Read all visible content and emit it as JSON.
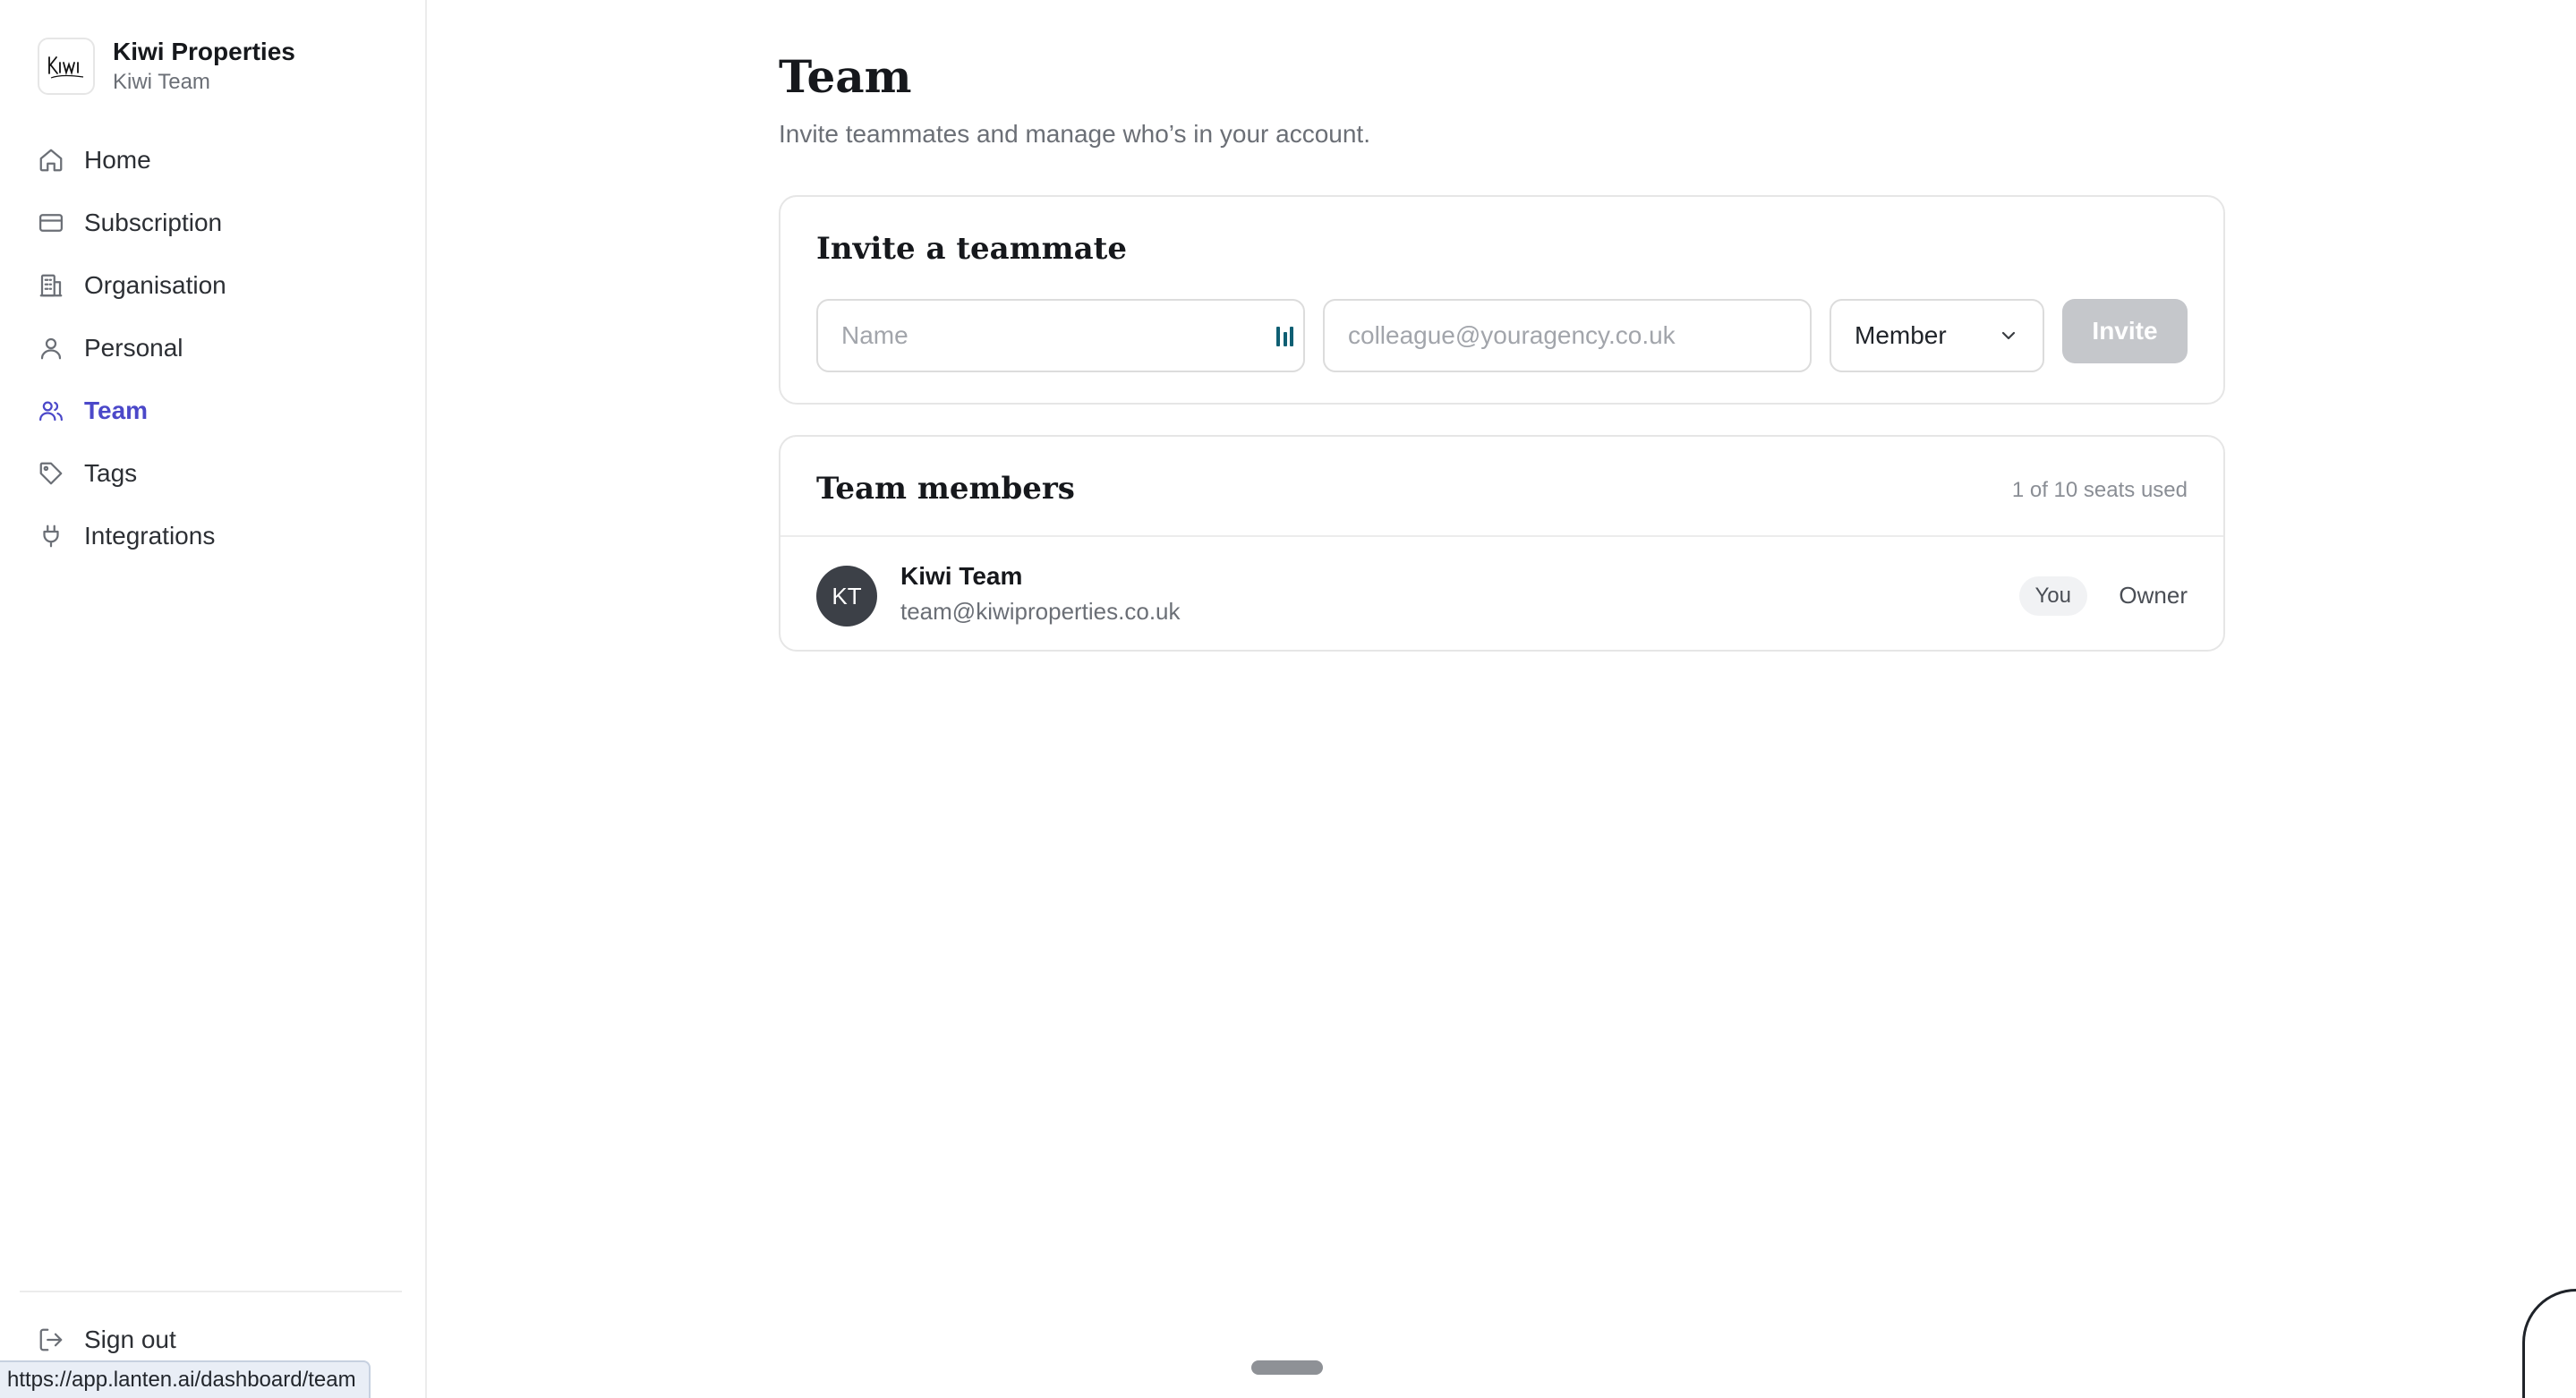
{
  "brand": {
    "name": "Kiwi Properties",
    "team": "Kiwi Team"
  },
  "nav": {
    "items": [
      {
        "label": "Home",
        "icon": "home-icon"
      },
      {
        "label": "Subscription",
        "icon": "credit-card-icon"
      },
      {
        "label": "Organisation",
        "icon": "building-icon"
      },
      {
        "label": "Personal",
        "icon": "user-icon"
      },
      {
        "label": "Team",
        "icon": "users-icon",
        "active": true
      },
      {
        "label": "Tags",
        "icon": "tag-icon"
      },
      {
        "label": "Integrations",
        "icon": "plug-icon"
      }
    ],
    "sign_out": "Sign out",
    "accent_color": "#4b48c9"
  },
  "status_url": "https://app.lanten.ai/dashboard/team",
  "page": {
    "title": "Team",
    "subtitle": "Invite teammates and manage who’s in your account."
  },
  "invite": {
    "title": "Invite a teammate",
    "name_placeholder": "Name",
    "email_placeholder": "colleague@youragency.co.uk",
    "role_value": "Member",
    "invite_label": "Invite"
  },
  "members": {
    "title": "Team members",
    "seats": "1 of 10 seats used",
    "list": [
      {
        "initials": "KT",
        "name": "Kiwi Team",
        "email": "team@kiwiproperties.co.uk",
        "badge": "You",
        "role": "Owner"
      }
    ]
  }
}
